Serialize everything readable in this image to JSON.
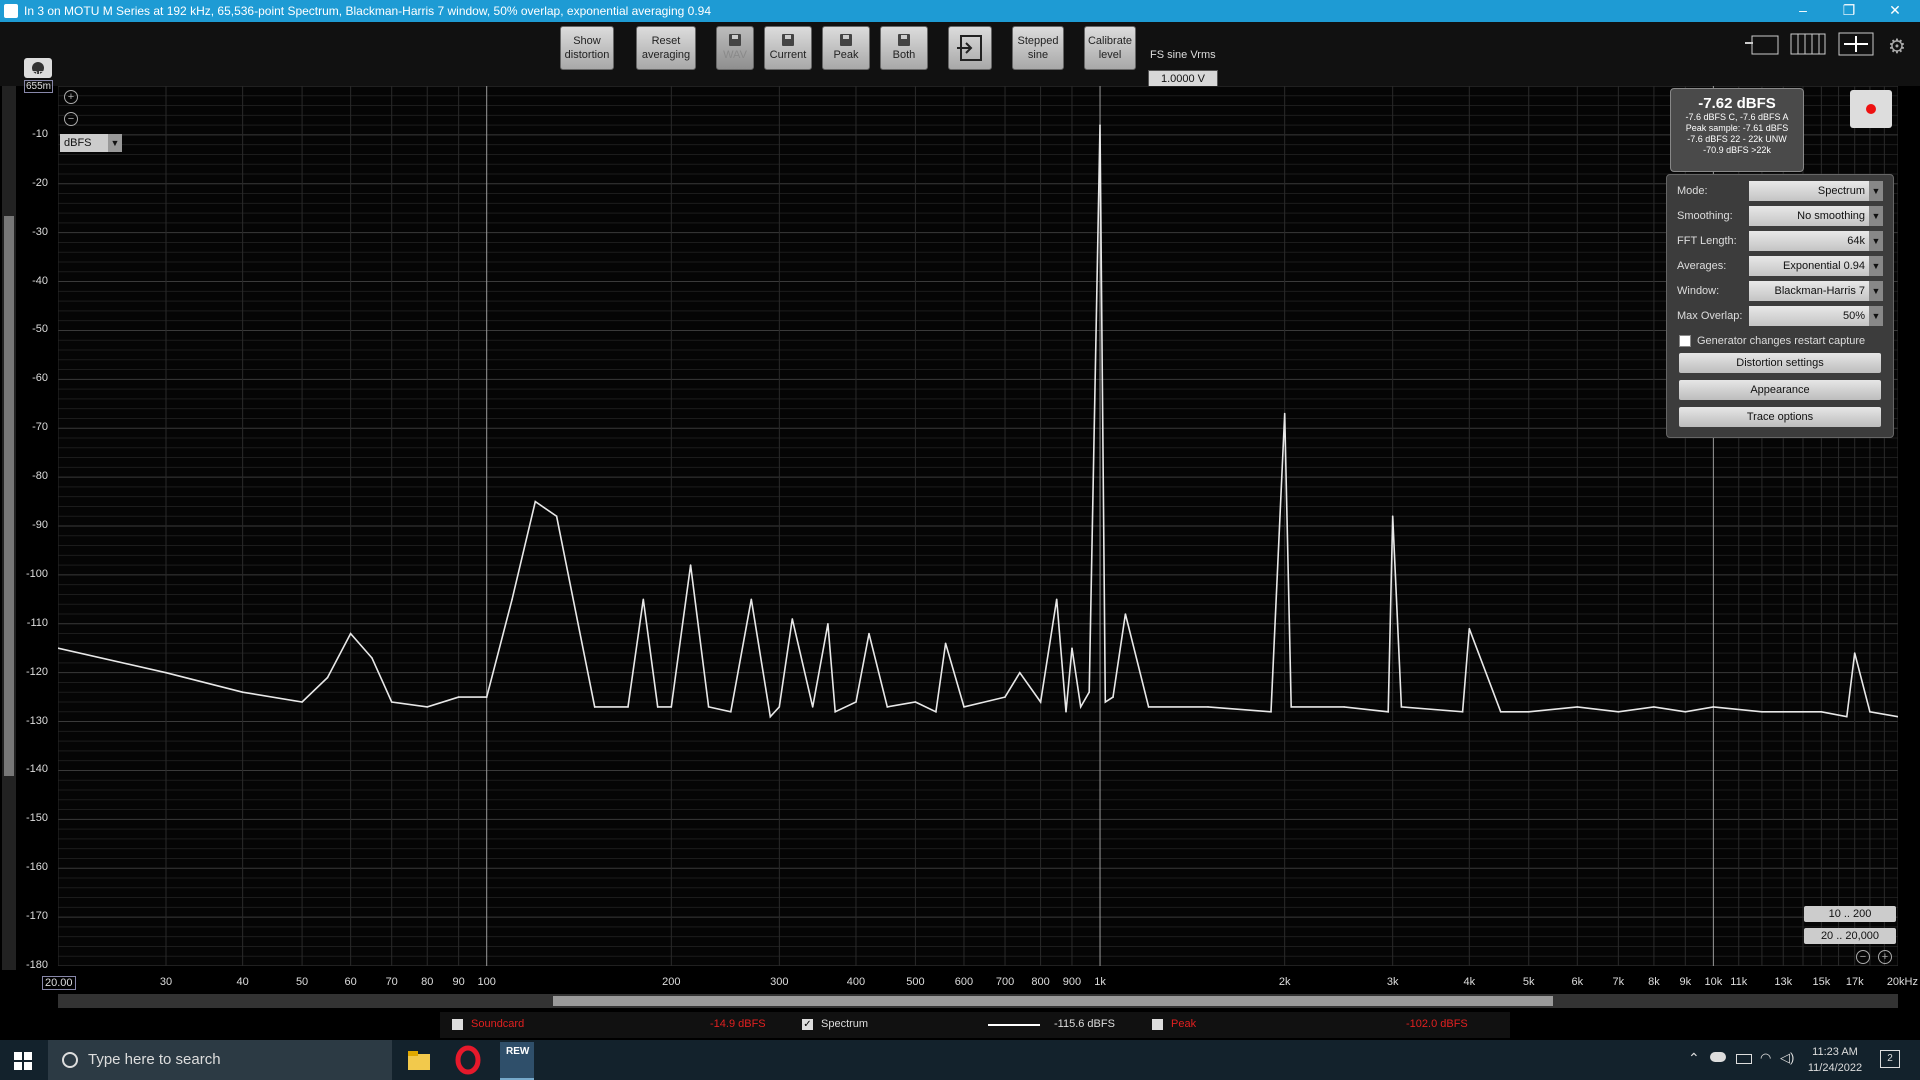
{
  "window": {
    "title": "In 3 on MOTU M Series at 192 kHz, 65,536-point Spectrum, Blackman-Harris 7 window, 50% overlap, exponential averaging 0.94",
    "min": "–",
    "max": "❐",
    "close": "✕"
  },
  "toolbar": {
    "show_distortion": "Show\ndistortion",
    "reset_averaging": "Reset\naveraging",
    "wav": "WAV",
    "current": "Current",
    "peak": "Peak",
    "both": "Both",
    "stepped_sine": "Stepped\nsine",
    "calibrate_level": "Calibrate\nlevel",
    "fs_label": "FS sine Vrms",
    "fs_value": "1.0000 V"
  },
  "plot": {
    "y_unit": "dBFS",
    "y_unit_sub": "655m",
    "unit_select": "dBFS",
    "y_ticks": [
      "-10",
      "-20",
      "-30",
      "-40",
      "-50",
      "-60",
      "-70",
      "-80",
      "-90",
      "-100",
      "-110",
      "-120",
      "-130",
      "-140",
      "-150",
      "-160",
      "-170",
      "-180"
    ],
    "x_ticks": [
      "20.00",
      "30",
      "40",
      "50",
      "60",
      "70",
      "80",
      "90",
      "100",
      "200",
      "300",
      "400",
      "500",
      "600",
      "700",
      "800",
      "900",
      "1k",
      "2k",
      "3k",
      "4k",
      "5k",
      "6k",
      "7k",
      "8k",
      "9k",
      "10k",
      "11k",
      "13k",
      "15k",
      "17k",
      "20kHz"
    ]
  },
  "level": {
    "main": "-7.62 dBFS",
    "l1": "-7.6 dBFS C, -7.6 dBFS A",
    "l2": "Peak sample: -7.61 dBFS",
    "l3": "-7.6 dBFS 22 - 22k UNW",
    "l4": "-70.9 dBFS >22k"
  },
  "settings": {
    "mode_label": "Mode:",
    "mode": "Spectrum",
    "smoothing_label": "Smoothing:",
    "smoothing": "No smoothing",
    "fft_label": "FFT Length:",
    "fft": "64k",
    "avg_label": "Averages:",
    "avg": "Exponential 0.94",
    "window_label": "Window:",
    "window": "Blackman-Harris 7",
    "overlap_label": "Max Overlap:",
    "overlap": "50%",
    "gen_restart": "Generator changes restart capture",
    "distortion_settings": "Distortion settings",
    "appearance": "Appearance",
    "trace_options": "Trace options"
  },
  "ranges": {
    "r1": "10 .. 200",
    "r2": "20 .. 20,000"
  },
  "legend": {
    "soundcard": "Soundcard",
    "soundcard_val": "-14.9 dBFS",
    "spectrum": "Spectrum",
    "spectrum_val": "-115.6 dBFS",
    "peak": "Peak",
    "peak_val": "-102.0 dBFS",
    "soundcard_color": "#e02020",
    "peak_color": "#e02020"
  },
  "taskbar": {
    "search_placeholder": "Type here to search",
    "time": "11:23 AM",
    "date": "11/24/2022",
    "notif": "2",
    "rew": "REW"
  },
  "chart_data": {
    "type": "line",
    "x_scale": "log",
    "xlim": [
      20,
      20000
    ],
    "ylim": [
      -180,
      0
    ],
    "ylabel": "dBFS",
    "grid": true,
    "series": [
      {
        "name": "Spectrum",
        "x": [
          20,
          30,
          40,
          50,
          55,
          60,
          65,
          70,
          80,
          90,
          100,
          110,
          120,
          130,
          150,
          170,
          180,
          190,
          200,
          215,
          230,
          250,
          270,
          290,
          300,
          315,
          340,
          360,
          370,
          400,
          420,
          450,
          500,
          540,
          560,
          600,
          700,
          740,
          800,
          850,
          880,
          900,
          930,
          960,
          1000,
          1020,
          1050,
          1100,
          1200,
          1500,
          1900,
          2000,
          2050,
          2500,
          2950,
          3000,
          3100,
          3900,
          4000,
          4500,
          5000,
          6000,
          7000,
          8000,
          9000,
          10000,
          12000,
          15000,
          16500,
          17000,
          18000,
          20000
        ],
        "y": [
          -115,
          -120,
          -124,
          -126,
          -121,
          -112,
          -117,
          -126,
          -127,
          -125,
          -125,
          -105,
          -85,
          -88,
          -127,
          -127,
          -105,
          -127,
          -127,
          -98,
          -127,
          -128,
          -105,
          -129,
          -127,
          -109,
          -127,
          -110,
          -128,
          -126,
          -112,
          -127,
          -126,
          -128,
          -114,
          -127,
          -125,
          -120,
          -126,
          -105,
          -128,
          -115,
          -127,
          -124,
          -8,
          -126,
          -125,
          -108,
          -127,
          -127,
          -128,
          -67,
          -127,
          -127,
          -128,
          -88,
          -127,
          -128,
          -111,
          -128,
          -128,
          -127,
          -128,
          -127,
          -128,
          -127,
          -128,
          -128,
          -129,
          -116,
          -128,
          -129
        ]
      }
    ]
  }
}
